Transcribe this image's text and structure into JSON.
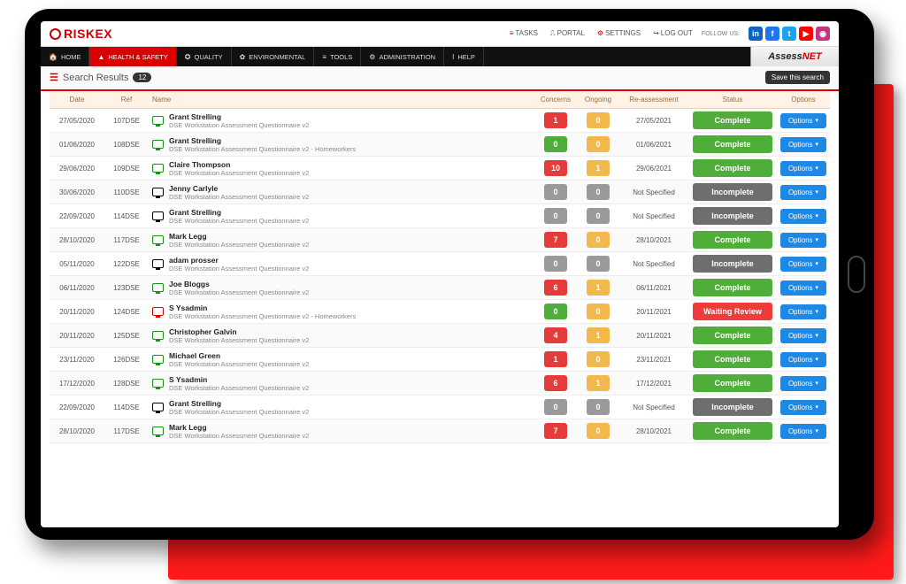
{
  "brand": {
    "name": "RISKEX",
    "product_prefix": "Assess",
    "product_suffix": "NET"
  },
  "topnav": {
    "tasks": "TASKS",
    "portal": "PORTAL",
    "settings": "SETTINGS",
    "logout": "LOG OUT",
    "follow": "FOLLOW US:"
  },
  "socials": [
    {
      "name": "linkedin",
      "bg": "#0a66c2",
      "glyph": "in"
    },
    {
      "name": "facebook",
      "bg": "#1877f2",
      "glyph": "f"
    },
    {
      "name": "twitter",
      "bg": "#1da1f2",
      "glyph": "t"
    },
    {
      "name": "youtube",
      "bg": "#ff0000",
      "glyph": "▶"
    },
    {
      "name": "instagram",
      "bg": "#c13584",
      "glyph": "◉"
    }
  ],
  "mainnav": [
    {
      "label": "HOME",
      "icon": "🏠"
    },
    {
      "label": "HEALTH & SAFETY",
      "icon": "▲",
      "active": true
    },
    {
      "label": "QUALITY",
      "icon": "✪"
    },
    {
      "label": "ENVIRONMENTAL",
      "icon": "✿"
    },
    {
      "label": "TOOLS",
      "icon": "≡"
    },
    {
      "label": "ADMINISTRATION",
      "icon": "⚙"
    },
    {
      "label": "HELP",
      "icon": "i"
    }
  ],
  "search": {
    "title": "Search Results",
    "count": "12",
    "save": "Save this search"
  },
  "columns": {
    "date": "Date",
    "ref": "Ref",
    "name": "Name",
    "concerns": "Concerns",
    "ongoing": "Ongoing",
    "reassess": "Re-assessment",
    "status": "Status",
    "options": "Options"
  },
  "options_label": "Options",
  "status_labels": {
    "Complete": "Complete",
    "Incomplete": "Incomplete",
    "Waiting Review": "Waiting Review"
  },
  "rows": [
    {
      "date": "27/05/2020",
      "ref": "107DSE",
      "person": "Grant Strelling",
      "desc": "DSE Workstation Assessment Questionnaire v2",
      "icon": "green",
      "concerns": "1",
      "c_cls": "b-red",
      "ongoing": "0",
      "o_cls": "b-orange",
      "reassess": "27/05/2021",
      "status": "Complete",
      "s_cls": "s-complete"
    },
    {
      "date": "01/06/2020",
      "ref": "108DSE",
      "person": "Grant Strelling",
      "desc": "DSE Workstation Assessment Questionnaire v2 - Homeworkers",
      "icon": "green",
      "concerns": "0",
      "c_cls": "b-green",
      "ongoing": "0",
      "o_cls": "b-orange",
      "reassess": "01/06/2021",
      "status": "Complete",
      "s_cls": "s-complete"
    },
    {
      "date": "29/06/2020",
      "ref": "109DSE",
      "person": "Claire Thompson",
      "desc": "DSE Workstation Assessment Questionnaire v2",
      "icon": "green",
      "concerns": "10",
      "c_cls": "b-red",
      "ongoing": "1",
      "o_cls": "b-orange",
      "reassess": "29/06/2021",
      "status": "Complete",
      "s_cls": "s-complete"
    },
    {
      "date": "30/06/2020",
      "ref": "110DSE",
      "person": "Jenny Carlyle",
      "desc": "DSE Workstation Assessment Questionnaire v2",
      "icon": "black",
      "concerns": "0",
      "c_cls": "b-grey",
      "ongoing": "0",
      "o_cls": "b-grey",
      "reassess": "Not Specified",
      "status": "Incomplete",
      "s_cls": "s-incomplete"
    },
    {
      "date": "22/09/2020",
      "ref": "114DSE",
      "person": "Grant Strelling",
      "desc": "DSE Workstation Assessment Questionnaire v2",
      "icon": "black",
      "concerns": "0",
      "c_cls": "b-grey",
      "ongoing": "0",
      "o_cls": "b-grey",
      "reassess": "Not Specified",
      "status": "Incomplete",
      "s_cls": "s-incomplete"
    },
    {
      "date": "28/10/2020",
      "ref": "117DSE",
      "person": "Mark Legg",
      "desc": "DSE Workstation Assessment Questionnaire v2",
      "icon": "green",
      "concerns": "7",
      "c_cls": "b-red",
      "ongoing": "0",
      "o_cls": "b-orange",
      "reassess": "28/10/2021",
      "status": "Complete",
      "s_cls": "s-complete"
    },
    {
      "date": "05/11/2020",
      "ref": "122DSE",
      "person": "adam prosser",
      "desc": "DSE Workstation Assessment Questionnaire v2",
      "icon": "black",
      "concerns": "0",
      "c_cls": "b-grey",
      "ongoing": "0",
      "o_cls": "b-grey",
      "reassess": "Not Specified",
      "status": "Incomplete",
      "s_cls": "s-incomplete"
    },
    {
      "date": "06/11/2020",
      "ref": "123DSE",
      "person": "Joe Bloggs",
      "desc": "DSE Workstation Assessment Questionnaire v2",
      "icon": "green",
      "concerns": "6",
      "c_cls": "b-red",
      "ongoing": "1",
      "o_cls": "b-orange",
      "reassess": "06/11/2021",
      "status": "Complete",
      "s_cls": "s-complete"
    },
    {
      "date": "20/11/2020",
      "ref": "124DSE",
      "person": "S Ysadmin",
      "desc": "DSE Workstation Assessment Questionnaire v2 - Homeworkers",
      "icon": "red",
      "concerns": "0",
      "c_cls": "b-green",
      "ongoing": "0",
      "o_cls": "b-orange",
      "reassess": "20/11/2021",
      "status": "Waiting Review",
      "s_cls": "s-review"
    },
    {
      "date": "20/11/2020",
      "ref": "125DSE",
      "person": "Christopher Galvin",
      "desc": "DSE Workstation Assessment Questionnaire v2",
      "icon": "green",
      "concerns": "4",
      "c_cls": "b-red",
      "ongoing": "1",
      "o_cls": "b-orange",
      "reassess": "20/11/2021",
      "status": "Complete",
      "s_cls": "s-complete"
    },
    {
      "date": "23/11/2020",
      "ref": "126DSE",
      "person": "Michael Green",
      "desc": "DSE Workstation Assessment Questionnaire v2",
      "icon": "green",
      "concerns": "1",
      "c_cls": "b-red",
      "ongoing": "0",
      "o_cls": "b-orange",
      "reassess": "23/11/2021",
      "status": "Complete",
      "s_cls": "s-complete"
    },
    {
      "date": "17/12/2020",
      "ref": "128DSE",
      "person": "S Ysadmin",
      "desc": "DSE Workstation Assessment Questionnaire v2",
      "icon": "green",
      "concerns": "6",
      "c_cls": "b-red",
      "ongoing": "1",
      "o_cls": "b-orange",
      "reassess": "17/12/2021",
      "status": "Complete",
      "s_cls": "s-complete"
    },
    {
      "date": "22/09/2020",
      "ref": "114DSE",
      "person": "Grant Strelling",
      "desc": "DSE Workstation Assessment Questionnaire v2",
      "icon": "black",
      "concerns": "0",
      "c_cls": "b-grey",
      "ongoing": "0",
      "o_cls": "b-grey",
      "reassess": "Not Specified",
      "status": "Incomplete",
      "s_cls": "s-incomplete"
    },
    {
      "date": "28/10/2020",
      "ref": "117DSE",
      "person": "Mark Legg",
      "desc": "DSE Workstation Assessment Questionnaire v2",
      "icon": "green",
      "concerns": "7",
      "c_cls": "b-red",
      "ongoing": "0",
      "o_cls": "b-orange",
      "reassess": "28/10/2021",
      "status": "Complete",
      "s_cls": "s-complete"
    }
  ]
}
